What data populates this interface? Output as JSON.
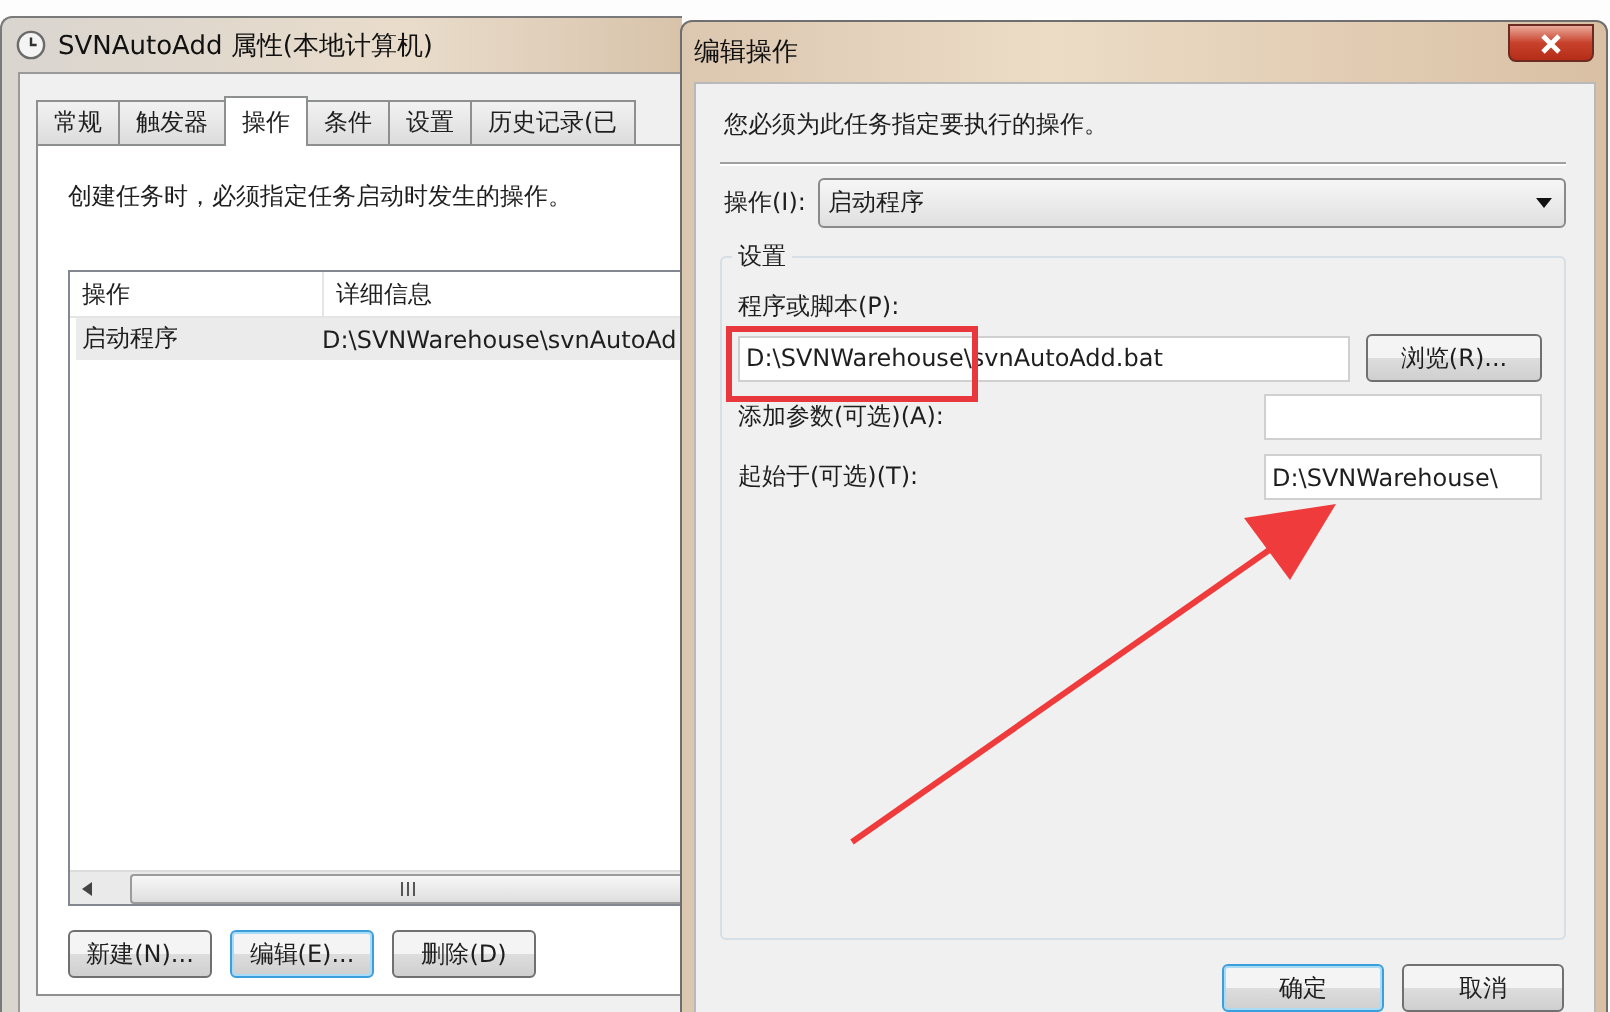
{
  "left_window": {
    "title": "SVNAutoAdd 属性(本地计算机)",
    "tabs": [
      {
        "label": "常规",
        "selected": false
      },
      {
        "label": "触发器",
        "selected": false
      },
      {
        "label": "操作",
        "selected": true
      },
      {
        "label": "条件",
        "selected": false
      },
      {
        "label": "设置",
        "selected": false
      },
      {
        "label": "历史记录(已",
        "selected": false
      }
    ],
    "description": "创建任务时，必须指定任务启动时发生的操作。",
    "columns": [
      "操作",
      "详细信息"
    ],
    "rows": [
      {
        "cells": [
          "启动程序",
          "D:\\SVNWarehouse\\svnAutoAd"
        ],
        "selected": true
      }
    ],
    "buttons": [
      {
        "label": "新建(N)...",
        "focused": false
      },
      {
        "label": "编辑(E)...",
        "focused": true
      },
      {
        "label": "删除(D)",
        "focused": false
      }
    ]
  },
  "dialog": {
    "title": "编辑操作",
    "description": "您必须为此任务指定要执行的操作。",
    "action": {
      "label": "操作(I):",
      "value": "启动程序"
    },
    "group_title": "设置",
    "program": {
      "label": "程序或脚本(P):",
      "value": "D:\\SVNWarehouse\\svnAutoAdd.bat"
    },
    "browse_button": "浏览(R)...",
    "arguments": {
      "label": "添加参数(可选)(A):"
    },
    "start_in": {
      "label": "起始于(可选)(T):",
      "value": "D:\\SVNWarehouse\\"
    },
    "buttons": [
      {
        "label": "确定",
        "focused": true
      },
      {
        "label": "取消",
        "focused": false
      }
    ]
  },
  "annotations": {
    "highlight_box": true,
    "arrow": true
  }
}
